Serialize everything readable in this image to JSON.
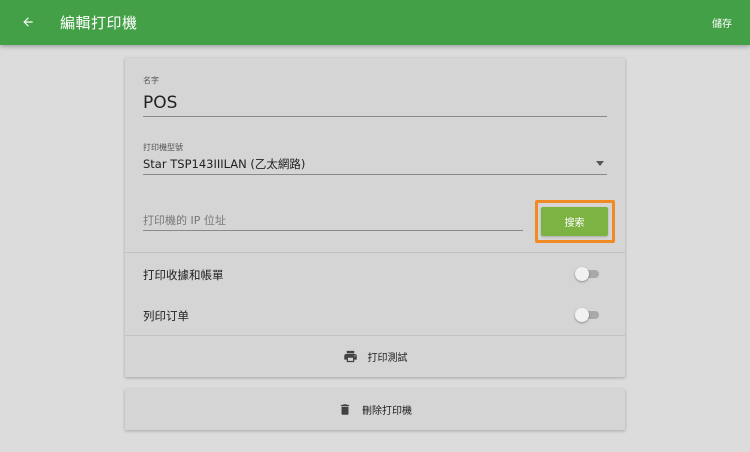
{
  "appbar": {
    "title": "編輯打印機",
    "save_label": "儲存",
    "back_icon": "arrow-left-icon",
    "color": "#43a047"
  },
  "form": {
    "name": {
      "label": "名字",
      "value": "POS"
    },
    "model": {
      "label": "打印機型號",
      "value": "Star TSP143IIILAN (乙太網路)"
    },
    "ip": {
      "placeholder": "打印機的 IP 位址",
      "value": ""
    },
    "search_label": "搜索",
    "search_color": "#7cb342",
    "highlight_color": "#f08a24"
  },
  "toggles": [
    {
      "label": "打印收據和帳單",
      "on": false
    },
    {
      "label": "列印订单",
      "on": false
    }
  ],
  "actions": {
    "test_print": {
      "label": "打印測試",
      "icon": "printer-icon"
    },
    "delete_printer": {
      "label": "刪除打印機",
      "icon": "trash-icon"
    }
  }
}
